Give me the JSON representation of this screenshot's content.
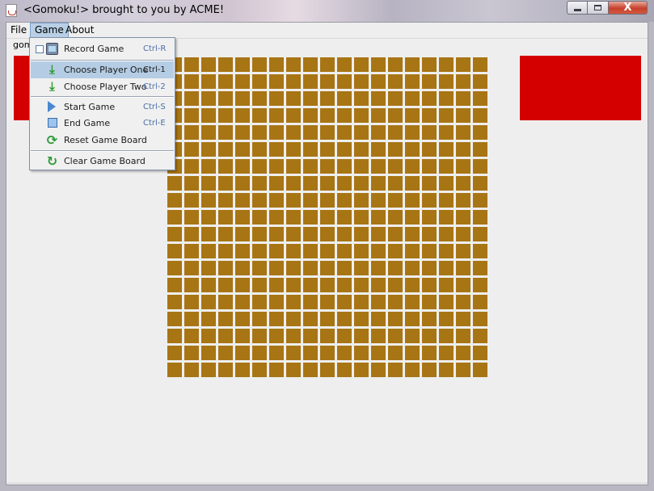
{
  "window": {
    "title": "<Gomoku!> brought to you by ACME!",
    "close_glyph": "X"
  },
  "menubar": {
    "file_label": "File",
    "game_label": "Game",
    "about_label": "About"
  },
  "toolbar": {
    "label": "gomo"
  },
  "game_menu": {
    "items": [
      {
        "label": "Record Game",
        "accel": "Ctrl-R",
        "icon": "tv-record-icon"
      },
      {
        "label": "Choose Player One",
        "accel": "Ctrl-1",
        "icon": "download-arrow-icon"
      },
      {
        "label": "Choose Player Two",
        "accel": "Ctrl-2",
        "icon": "download-arrow-icon"
      },
      {
        "label": "Start Game",
        "accel": "Ctrl-S",
        "icon": "play-icon"
      },
      {
        "label": "End Game",
        "accel": "Ctrl-E",
        "icon": "stop-icon"
      },
      {
        "label": "Reset Game Board",
        "accel": "",
        "icon": "recycle-icon"
      },
      {
        "label": "Clear Game Board",
        "accel": "",
        "icon": "refresh-icon"
      }
    ],
    "highlighted_item": "Choose Player One"
  },
  "board": {
    "rows": 19,
    "cols": 19,
    "cell_color": "#a87514"
  },
  "colors": {
    "player_panel": "#d40000",
    "menu_highlight": "#b5cde4"
  }
}
